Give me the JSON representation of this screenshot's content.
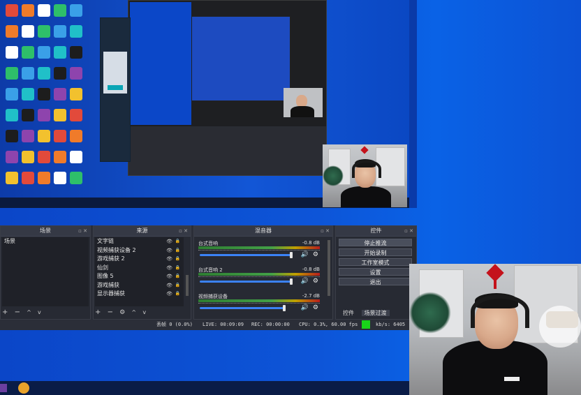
{
  "panels": {
    "scenes": {
      "title": "场景",
      "items": [
        "场景"
      ]
    },
    "sources": {
      "title": "来源",
      "items": [
        "文字链",
        "视频捕获设备 2",
        "游戏捕获 2",
        "仙剑",
        "图像 5",
        "游戏捕获",
        "显示器捕获"
      ]
    },
    "mixer": {
      "title": "混音器",
      "channels": [
        {
          "name": "台式音响",
          "db": "-0.8 dB",
          "level": 0.92
        },
        {
          "name": "台式音响 2",
          "db": "-0.8 dB",
          "level": 0.92
        },
        {
          "name": "视频捕获设备",
          "db": "-2.7 dB",
          "level": 0.85
        }
      ]
    },
    "controls": {
      "title": "控件",
      "buttons": [
        "停止推流",
        "开始录制",
        "工作室模式",
        "设置",
        "退出"
      ],
      "tabs": [
        "控件",
        "场景过渡"
      ]
    }
  },
  "status": {
    "dropped": "丢帧 0 (0.0%)",
    "live": "LIVE: 00:09:09",
    "rec": "REC: 00:00:00",
    "cpu": "CPU: 0.3%, 60.00 fps",
    "kbps": "kb/s: 6405"
  },
  "toolbar_glyphs": {
    "add": "+",
    "remove": "−",
    "gear": "⚙",
    "up": "^",
    "down": "v"
  },
  "icons": {
    "eye": "👁",
    "lock": "🔒",
    "speaker": "🔊",
    "gear": "⚙"
  },
  "colors": {
    "live_indicator": "#19d419",
    "wallpaper": "#0b46c8",
    "obs_panel": "#272a33"
  }
}
